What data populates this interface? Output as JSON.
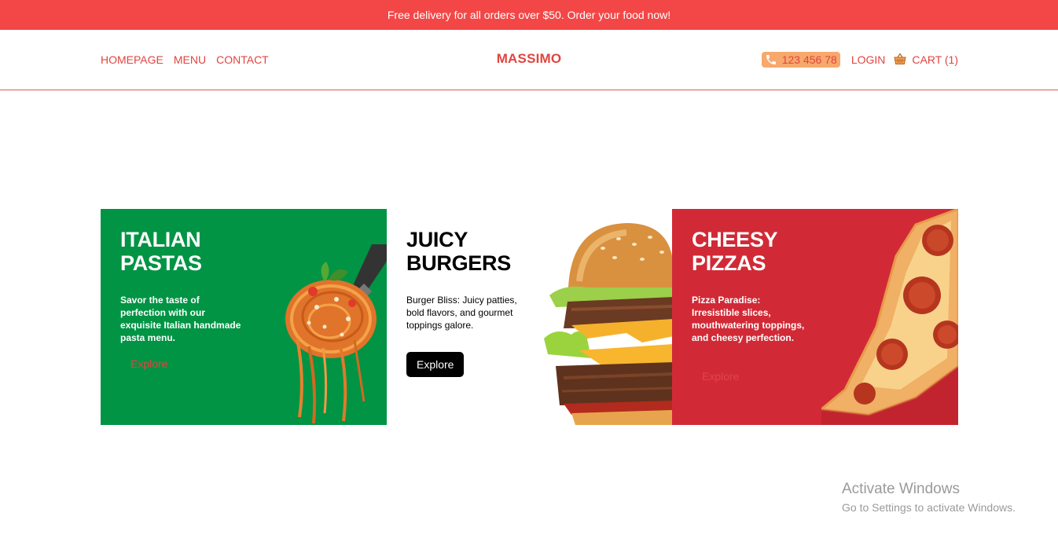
{
  "banner": {
    "text": "Free delivery for all orders over $50. Order your food now!"
  },
  "nav": {
    "links": [
      "HOMEPAGE",
      "MENU",
      "CONTACT"
    ],
    "logo": "MASSIMO",
    "phone": "123 456 78",
    "login": "LOGIN",
    "cart": "CART (1)"
  },
  "cards": [
    {
      "title": "ITALIAN PASTAS",
      "description": "Savor the taste of perfection with our exquisite Italian handmade pasta menu.",
      "button": "Explore",
      "image": "pasta-fork-image"
    },
    {
      "title": "JUICY BURGERS",
      "description": "Burger Bliss: Juicy patties, bold flavors, and gourmet toppings galore.",
      "button": "Explore",
      "image": "burger-image"
    },
    {
      "title": "CHEESY PIZZAS",
      "description": "Pizza Paradise: Irresistible slices, mouthwatering toppings, and cheesy perfection.",
      "button": "Explore",
      "image": "pizza-slice-image"
    }
  ],
  "watermark": {
    "title": "Activate Windows",
    "subtitle": "Go to Settings to activate Windows."
  },
  "colors": {
    "brand_red": "#f34747",
    "nav_text": "#e0453f",
    "phone_pill": "#f7a86c",
    "pasta_card": "#009444",
    "pizza_card": "#d12a36"
  }
}
